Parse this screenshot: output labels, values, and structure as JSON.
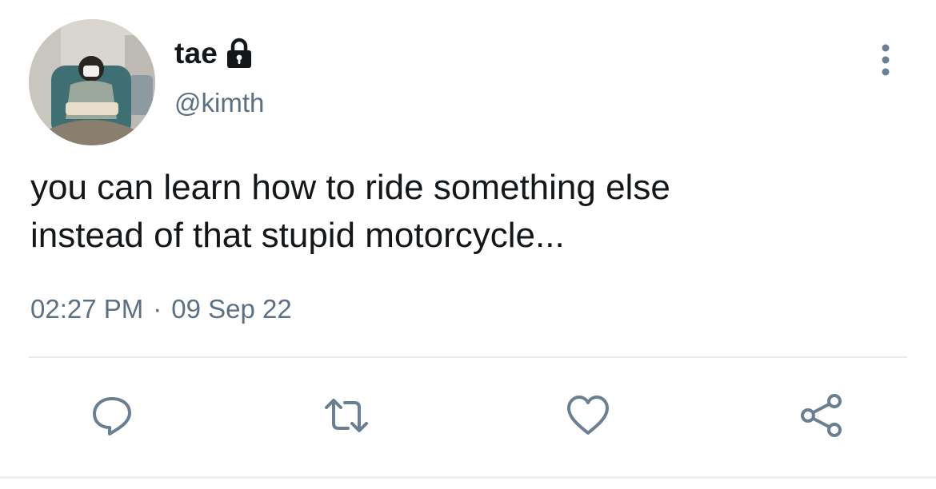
{
  "author": {
    "display_name": "tae",
    "handle": "@kimth",
    "protected": true,
    "avatar_icon": "profile-photo",
    "lock_icon": "lock-icon"
  },
  "tweet": {
    "text": "you can learn how to ride something else\ninstead of that stupid motorcycle...",
    "time": "02:27 PM",
    "separator": "·",
    "date": "09 Sep 22"
  },
  "actions": [
    {
      "name": "reply",
      "icon": "reply-icon"
    },
    {
      "name": "retweet",
      "icon": "retweet-icon"
    },
    {
      "name": "like",
      "icon": "heart-icon"
    },
    {
      "name": "share",
      "icon": "share-icon"
    }
  ],
  "colors": {
    "primary_text": "#14171a",
    "secondary_text": "#5b7083",
    "icon": "#6b7f92",
    "divider": "#e6ecf0"
  }
}
